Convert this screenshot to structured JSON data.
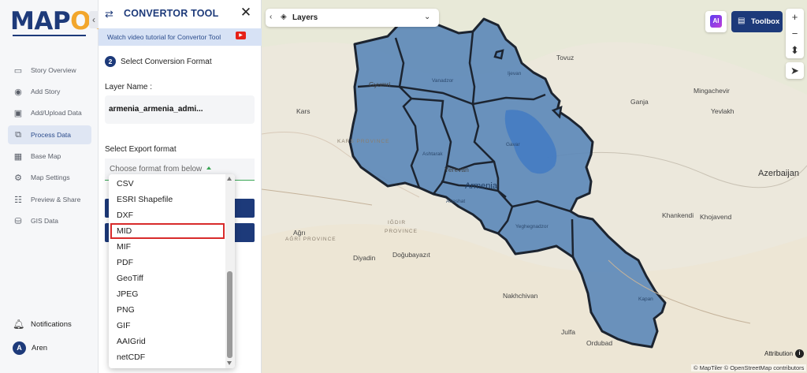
{
  "app": {
    "logo_left": "MAP",
    "logo_right": "OG",
    "collapse_icon": "chevron-left-icon"
  },
  "nav": {
    "items": [
      {
        "label": "Story Overview",
        "icon": "map-icon"
      },
      {
        "label": "Add Story",
        "icon": "pin-icon"
      },
      {
        "label": "Add/Upload Data",
        "icon": "upload-icon"
      },
      {
        "label": "Process Data",
        "icon": "process-icon",
        "active": true
      },
      {
        "label": "Base Map",
        "icon": "basemap-icon"
      },
      {
        "label": "Map Settings",
        "icon": "gear-icon"
      },
      {
        "label": "Preview & Share",
        "icon": "share-icon"
      },
      {
        "label": "GIS Data",
        "icon": "database-icon"
      }
    ],
    "notifications": "Notifications",
    "user": {
      "initial": "A",
      "name": "Aren"
    }
  },
  "panel": {
    "title": "CONVERTOR TOOL",
    "tutorial": "Watch video tutorial for Convertor Tool",
    "step_num": "2",
    "step_label": "Select Conversion Format",
    "layer_name_label": "Layer Name :",
    "layer_name_value": "armenia_armenia_admi...",
    "export_label": "Select Export format",
    "export_placeholder": "Choose format from below"
  },
  "dropdown": {
    "options": [
      "CSV",
      "ESRI Shapefile",
      "DXF",
      "MID",
      "MIF",
      "PDF",
      "GeoTiff",
      "JPEG",
      "PNG",
      "GIF",
      "AAIGrid",
      "netCDF"
    ],
    "highlighted": "MID"
  },
  "map_toolbar": {
    "layers_label": "Layers",
    "ai_label": "AI",
    "toolbox_label": "Toolbox",
    "zoom_in": "+",
    "zoom_out": "−"
  },
  "map_labels": {
    "gyumri": "Gyumri",
    "vanadzor": "Vanadzor",
    "ijevan": "Ijevan",
    "tovuz": "Tovuz",
    "ganja": "Ganja",
    "mingachevir": "Mingachevir",
    "yevlakh": "Yevlakh",
    "kars": "Kars",
    "kars_prov": "KARS PROVINCE",
    "gavar": "Gavar",
    "ashtarak": "Ashtarak",
    "yerevan": "Yerevan",
    "armenia": "Armenia",
    "artashat": "Artashat",
    "azerbaijan": "Azerbaijan",
    "khankendi": "Khankendi",
    "khojavend": "Khojavend",
    "igdir": "IĞDIR",
    "igdir_prov": "PROVINCE",
    "agri": "Ağrı",
    "agri_prov": "AĞRI PROVINCE",
    "dogubayazit": "Doğubayazıt",
    "diyadin": "Diyadin",
    "yeghegnadzor": "Yeghegnadzor",
    "nakhchivan": "Nakhchivan",
    "kapan": "Kapan",
    "julfa": "Julfa",
    "ordubad": "Ordubad"
  },
  "attribution": {
    "label": "Attribution",
    "info": "i",
    "footer": "© MapTiler © OpenStreetMap contributors"
  },
  "colors": {
    "brand": "#1d3a7a",
    "accent": "#f2a62c",
    "region_fill": "#5b87b8",
    "highlight": "#d82b2b",
    "land": "#ede9df"
  }
}
